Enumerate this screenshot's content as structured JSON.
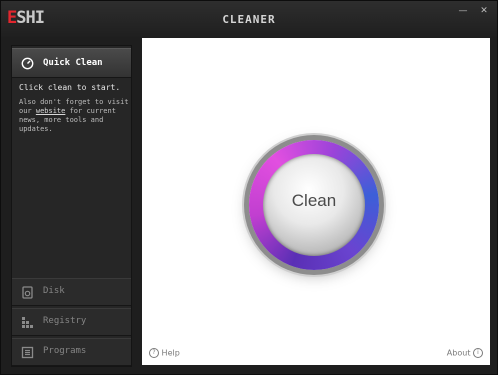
{
  "window": {
    "logo_first": "E",
    "logo_rest": "SHI",
    "title": "CLEANER",
    "minimize_glyph": "—",
    "close_glyph": "✕"
  },
  "sidebar": {
    "quick_clean": {
      "label": "Quick Clean",
      "icon": "gauge-icon"
    },
    "info": {
      "primary": "Click clean to start.",
      "secondary_before": "Also don't forget to visit our ",
      "link": "website",
      "secondary_after": " for current news, more tools and updates."
    },
    "items": [
      {
        "label": "Disk",
        "icon": "disk-icon"
      },
      {
        "label": "Registry",
        "icon": "registry-icon"
      },
      {
        "label": "Programs",
        "icon": "programs-icon"
      }
    ]
  },
  "main": {
    "clean_label": "Clean",
    "help_label": "Help",
    "about_label": "About"
  },
  "colors": {
    "accent_purple": "#c13fd0",
    "logo_red": "#e2262e"
  }
}
